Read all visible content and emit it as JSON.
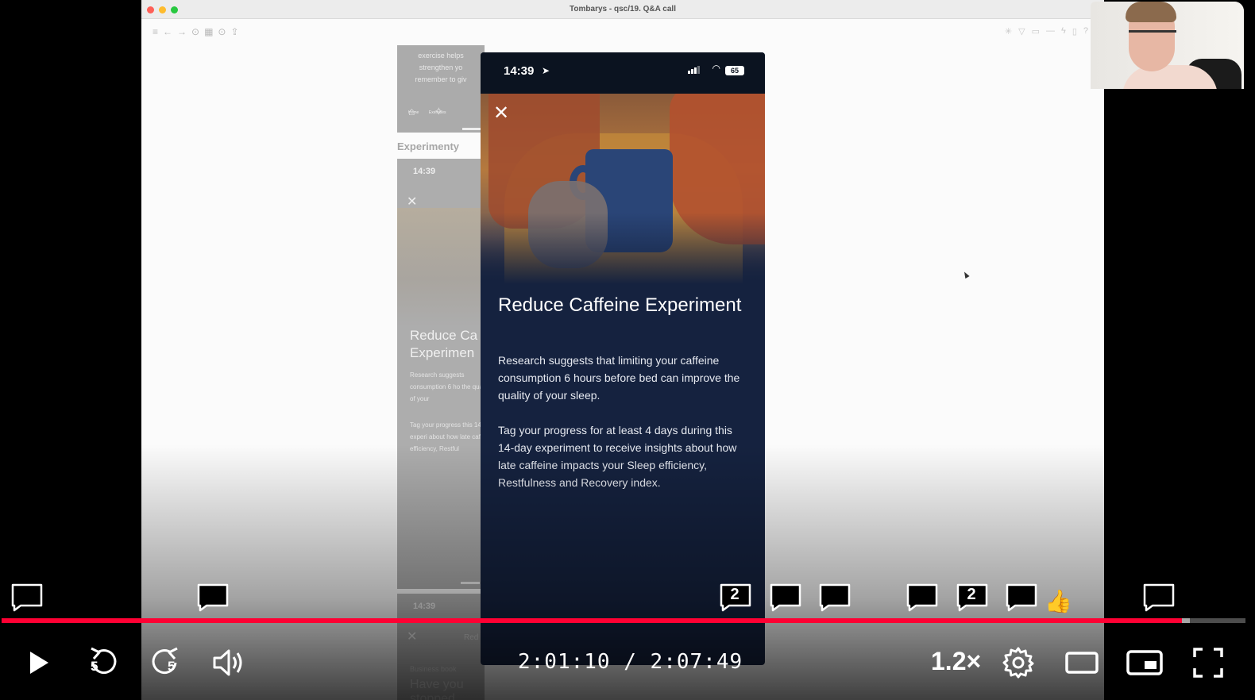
{
  "window": {
    "title": "Tombarys - qsc/19. Q&A call"
  },
  "design_canvas": {
    "section_label": "Experimenty",
    "top_frame_text": [
      "exercise helps",
      "strengthen yo",
      "remember to giv"
    ],
    "top_frame_nav": [
      "Home",
      "Exercises"
    ],
    "mid_frame": {
      "time": "14:39",
      "title_fragment": "Reduce Ca Experimen",
      "body1": "Research suggests consumption 6 ho the quality of your",
      "body2": "Tag your progress this 14-day experi about how late caf efficiency, Restful"
    },
    "bottom_frame": {
      "time": "14:39",
      "red_fragment": "Red",
      "small": "Business book",
      "big": "Have you stopped"
    }
  },
  "phone": {
    "status": {
      "time": "14:39",
      "battery": "65"
    },
    "close_icon": "close-icon",
    "title": "Reduce Caffeine Experiment",
    "paragraph1": "Research suggests that limiting your caffeine consumption 6 hours before bed can improve the quality of your sleep.",
    "paragraph2": "Tag your progress for at least 4 days during this 14-day experiment to receive insights about how late caffeine impacts your Sleep efficiency, Restfulness and Recovery index."
  },
  "chapter_markers": {
    "counts": [
      "2",
      "2"
    ],
    "reaction": "👍"
  },
  "player": {
    "current_time": "2:01:10",
    "separator": "/",
    "duration": "2:07:49",
    "speed": "1.2×",
    "skip_back_seconds": "5",
    "skip_forward_seconds": "5",
    "progress_fraction": 0.949,
    "loaded_fraction": 0.955,
    "colors": {
      "progress": "#ff0033",
      "phone_bg": "#15223f"
    }
  }
}
